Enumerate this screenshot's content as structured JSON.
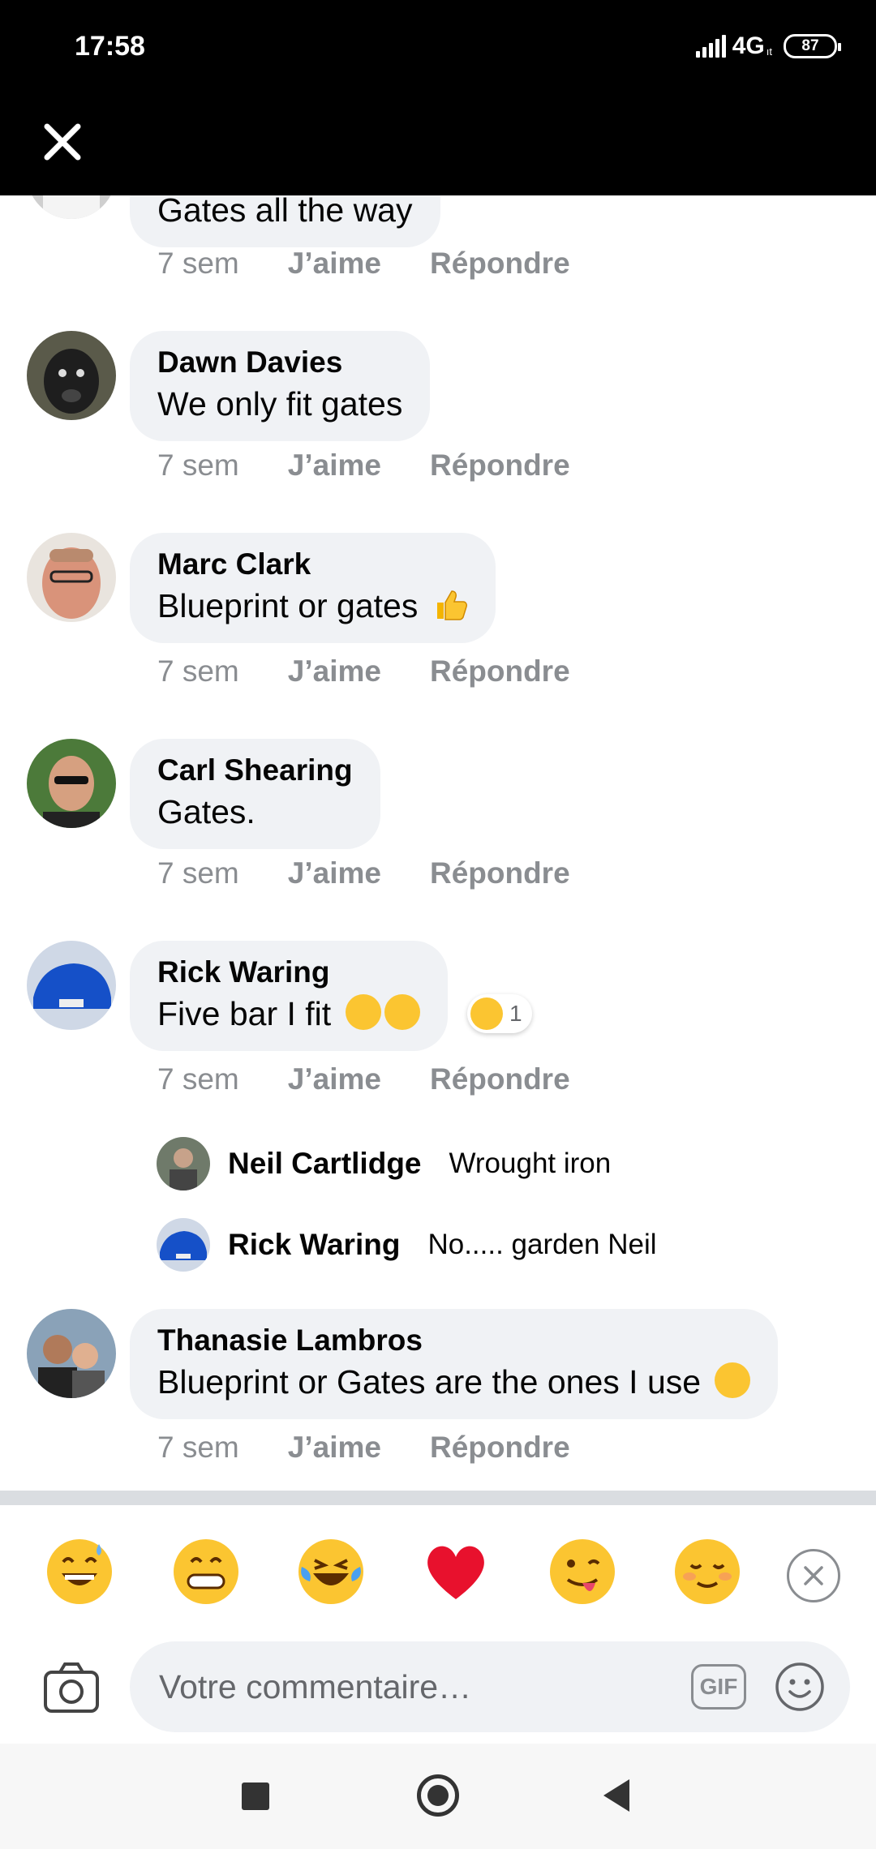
{
  "status_bar": {
    "time": "17:58",
    "network": "4G",
    "network_sub": "ıt",
    "battery": "87"
  },
  "top_bar": {
    "close_icon": "close-icon"
  },
  "comments": [
    {
      "author": "",
      "text": "Gates all the way",
      "time": "7 sem",
      "like": "J’aime",
      "reply": "Répondre"
    },
    {
      "author": "Dawn Davies",
      "text": "We only fit gates",
      "time": "7 sem",
      "like": "J’aime",
      "reply": "Répondre"
    },
    {
      "author": "Marc Clark",
      "text": "Blueprint or gates",
      "emojis": [
        "thumbs-up-emoji"
      ],
      "time": "7 sem",
      "like": "J’aime",
      "reply": "Répondre"
    },
    {
      "author": "Carl Shearing",
      "text": "Gates.",
      "time": "7 sem",
      "like": "J’aime",
      "reply": "Répondre"
    },
    {
      "author": "Rick Waring",
      "text": "Five bar I fit",
      "emojis": [
        "thinking-face-emoji",
        "smirking-face-emoji"
      ],
      "reaction_count": "1",
      "time": "7 sem",
      "like": "J’aime",
      "reply": "Répondre",
      "replies": [
        {
          "author": "Neil Cartlidge",
          "text": "Wrought iron"
        },
        {
          "author": "Rick Waring",
          "text": "No..... garden Neil"
        }
      ]
    },
    {
      "author": "Thanasie Lambros",
      "text": "Blueprint or Gates are the ones I use",
      "emojis": [
        "winking-face-emoji"
      ],
      "time": "7 sem",
      "like": "J’aime",
      "reply": "Répondre"
    }
  ],
  "quick_emojis": [
    "grinning-sweat-emoji",
    "beaming-face-emoji",
    "crying-laughing-emoji",
    "red-heart-emoji",
    "winking-tongue-emoji",
    "relieved-face-emoji"
  ],
  "composer": {
    "placeholder": "Votre commentaire…",
    "gif_label": "GIF"
  },
  "colors": {
    "bubble": "#f0f2f5",
    "meta": "#8a8d91",
    "text": "#050505"
  }
}
